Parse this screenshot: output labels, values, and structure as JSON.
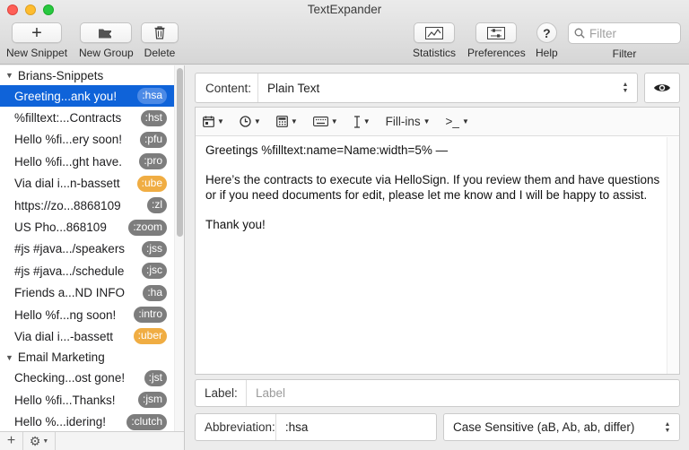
{
  "window": {
    "title": "TextExpander"
  },
  "toolbar": {
    "new_snippet": "New Snippet",
    "new_group": "New Group",
    "delete": "Delete",
    "statistics": "Statistics",
    "preferences": "Preferences",
    "help": "Help",
    "help_glyph": "?",
    "filter_label": "Filter",
    "filter_placeholder": "Filter"
  },
  "sidebar": {
    "groups": [
      {
        "name": "Brians-Snippets",
        "items": [
          {
            "label": "Greeting...ank you!",
            "abbr": ":hsa",
            "selected": true,
            "badge": "gray"
          },
          {
            "label": "%filltext:...Contracts",
            "abbr": ":hst",
            "badge": "gray"
          },
          {
            "label": "Hello %fi...ery soon!",
            "abbr": ":pfu",
            "badge": "gray"
          },
          {
            "label": "Hello %fi...ght have.",
            "abbr": ":pro",
            "badge": "gray"
          },
          {
            "label": "Via dial i...n-bassett",
            "abbr": ":ube",
            "badge": "orange"
          },
          {
            "label": "https://zo...8868109",
            "abbr": ":zl",
            "badge": "gray"
          },
          {
            "label": "US Pho...868109",
            "abbr": ":zoom",
            "badge": "gray"
          },
          {
            "label": "#js #java.../speakers",
            "abbr": ":jss",
            "badge": "gray"
          },
          {
            "label": "#js #java.../schedule",
            "abbr": ":jsc",
            "badge": "gray"
          },
          {
            "label": "Friends a...ND INFO",
            "abbr": ":ha",
            "badge": "gray"
          },
          {
            "label": "Hello %f...ng soon!",
            "abbr": ":intro",
            "badge": "gray"
          },
          {
            "label": "Via dial i...-bassett",
            "abbr": ":uber",
            "badge": "orange"
          }
        ]
      },
      {
        "name": "Email Marketing",
        "items": [
          {
            "label": "Checking...ost gone!",
            "abbr": ":jst",
            "badge": "gray"
          },
          {
            "label": "Hello %fi...Thanks!",
            "abbr": ":jsm",
            "badge": "gray"
          },
          {
            "label": "Hello %...idering!",
            "abbr": ":clutch",
            "badge": "gray"
          }
        ]
      }
    ]
  },
  "content": {
    "label": "Content:",
    "type": "Plain Text"
  },
  "editor_toolbar": {
    "fill_ins": "Fill-ins",
    "script": ">_"
  },
  "editor": {
    "paragraphs": [
      "Greetings %filltext:name=Name:width=5% —",
      "Here’s the contracts to execute via HelloSign. If you review them and have questions or if you need documents for edit, please let me know and I will be happy to assist.",
      "Thank you!"
    ]
  },
  "label_field": {
    "label": "Label:",
    "placeholder": "Label",
    "value": ""
  },
  "abbreviation_field": {
    "label": "Abbreviation:",
    "value": ":hsa"
  },
  "case_select": {
    "value": "Case Sensitive (aB, Ab, ab, differ)"
  },
  "colors": {
    "selection": "#0f63d9",
    "badge_gray": "#7d7d7d",
    "badge_orange": "#f0ad43"
  }
}
